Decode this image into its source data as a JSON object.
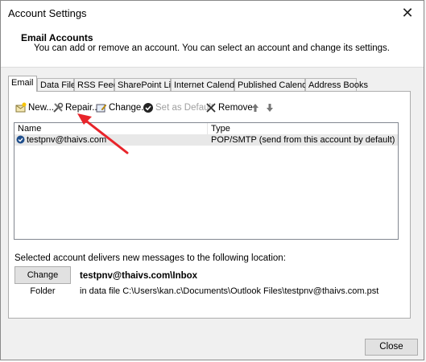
{
  "window": {
    "title": "Account Settings"
  },
  "header": {
    "title": "Email Accounts",
    "description": "You can add or remove an account. You can select an account and change its settings."
  },
  "tabs": [
    {
      "label": "Email",
      "active": true
    },
    {
      "label": "Data Files"
    },
    {
      "label": "RSS Feeds"
    },
    {
      "label": "SharePoint Lists"
    },
    {
      "label": "Internet Calendars"
    },
    {
      "label": "Published Calendars"
    },
    {
      "label": "Address Books"
    }
  ],
  "toolbar": {
    "new_label": "New...",
    "repair_label": "Repair...",
    "change_label": "Change...",
    "default_label": "Set as Default",
    "remove_label": "Remove"
  },
  "accounts": {
    "columns": [
      "Name",
      "Type"
    ],
    "rows": [
      {
        "name": "testpnv@thaivs.com",
        "type": "POP/SMTP (send from this account by default)"
      }
    ]
  },
  "delivery": {
    "text": "Selected account delivers new messages to the following location:",
    "change_folder_label": "Change Folder",
    "folder_path": "testpnv@thaivs.com\\Inbox",
    "data_file": "in data file C:\\Users\\kan.c\\Documents\\Outlook Files\\testpnv@thaivs.com.pst"
  },
  "buttons": {
    "close_label": "Close"
  },
  "colors": {
    "annotation_arrow": "#e8242a",
    "check_icon": "#1f4e8c"
  }
}
